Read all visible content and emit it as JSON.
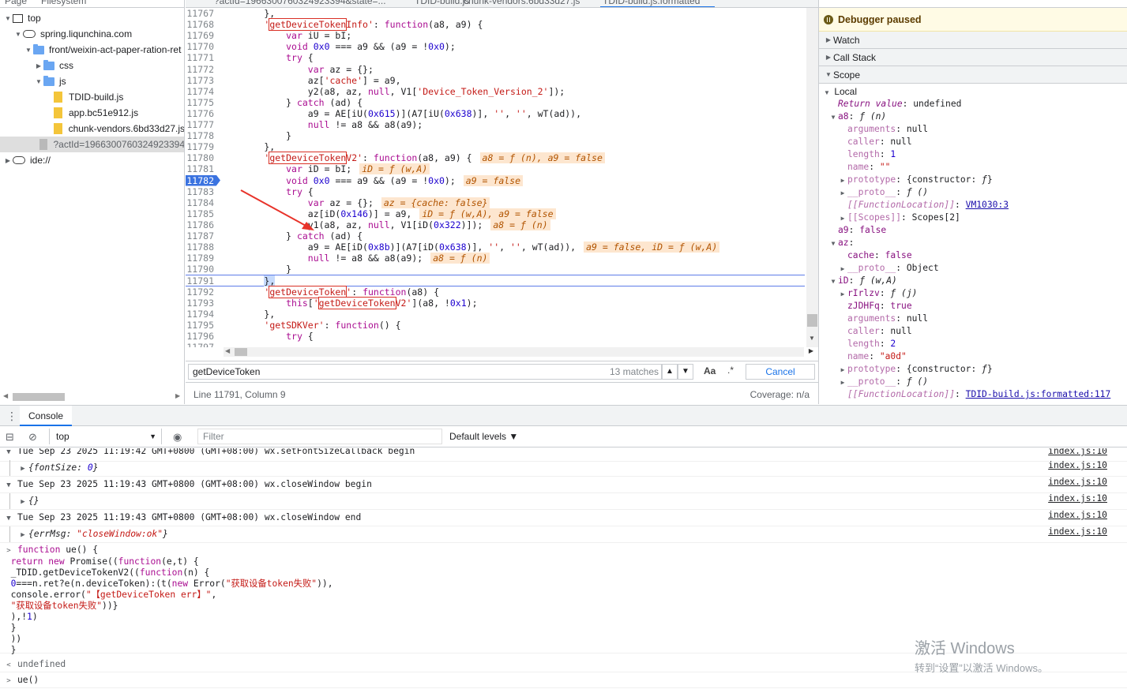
{
  "navigator": {
    "tab_page": "Page",
    "tab_filesystem": "Filesystem",
    "tree": [
      {
        "label": "top",
        "depth": 0,
        "kind": "frame",
        "tw": "▼"
      },
      {
        "label": "spring.liqunchina.com",
        "depth": 1,
        "kind": "cloud",
        "tw": "▼"
      },
      {
        "label": "front/weixin-act-paper-ration-ret",
        "depth": 2,
        "kind": "folder",
        "tw": "▼"
      },
      {
        "label": "css",
        "depth": 3,
        "kind": "folder",
        "tw": "▶"
      },
      {
        "label": "js",
        "depth": 3,
        "kind": "folder",
        "tw": "▼"
      },
      {
        "label": "TDID-build.js",
        "depth": 4,
        "kind": "file",
        "tw": ""
      },
      {
        "label": "app.bc51e912.js",
        "depth": 4,
        "kind": "file",
        "tw": ""
      },
      {
        "label": "chunk-vendors.6bd33d27.js",
        "depth": 4,
        "kind": "file",
        "tw": ""
      },
      {
        "label": "?actId=1966300760324923394",
        "depth": 3,
        "kind": "file-grey",
        "tw": "",
        "selected": true
      },
      {
        "label": "ide://",
        "depth": 0,
        "kind": "cloud",
        "tw": "▶"
      }
    ]
  },
  "editor": {
    "tabs": [
      "?actId=1966300760324923394&state=...",
      "TDID-build.js",
      "chunk-vendors.6bd33d27.js",
      "TDID-build.js:formatted"
    ],
    "search": {
      "query": "getDeviceToken",
      "count": "13 matches",
      "cancel": "Cancel",
      "aa": "Aa",
      "regex": ".*"
    },
    "status": {
      "position": "Line 11791, Column 9",
      "coverage": "Coverage: n/a"
    }
  },
  "debugger": {
    "paused": "Debugger paused",
    "sections": {
      "watch": "Watch",
      "callstack": "Call Stack",
      "scope": "Scope"
    }
  },
  "console": {
    "tab": "Console",
    "context": "top",
    "filter_placeholder": "Filter",
    "levels": "Default levels ▼",
    "src_link": "index.js:10"
  },
  "watermark": {
    "line1": "激活 Windows",
    "line2": "转到“设置”以激活 Windows。"
  },
  "colors": {
    "accent": "#1a73e8",
    "breakpoint": "#3b73e0",
    "paused_bg": "#fffbe5",
    "inline_value_bg": "#fde6cf",
    "annotation_arrow": "#e8332a"
  }
}
